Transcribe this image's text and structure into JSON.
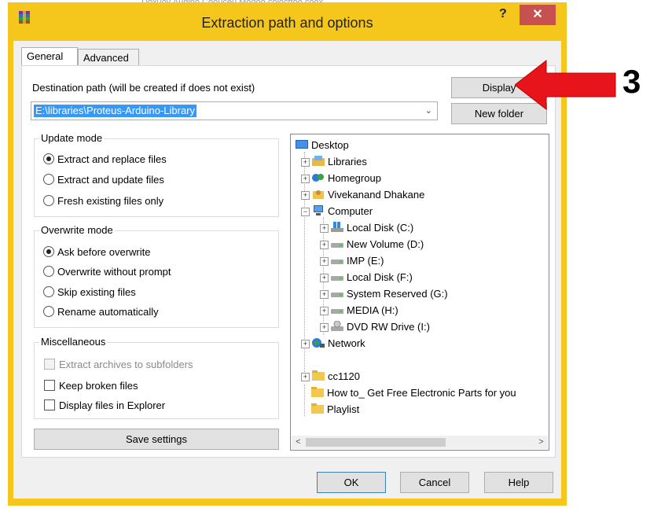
{
  "window": {
    "title": "Extraction path and options",
    "help_label": "?",
    "close_label": "✕"
  },
  "tabs": [
    "General",
    "Advanced"
  ],
  "destination": {
    "label": "Destination path (will be created if does not exist)",
    "value": "E:\\libraries\\Proteus-Arduino-Library"
  },
  "buttons": {
    "display": "Display",
    "new_folder": "New folder",
    "save_settings": "Save settings",
    "ok": "OK",
    "cancel": "Cancel",
    "help": "Help"
  },
  "update_mode": {
    "title": "Update mode",
    "options": [
      "Extract and replace files",
      "Extract and update files",
      "Fresh existing files only"
    ],
    "selected_index": 0
  },
  "overwrite_mode": {
    "title": "Overwrite mode",
    "options": [
      "Ask before overwrite",
      "Overwrite without prompt",
      "Skip existing files",
      "Rename automatically"
    ],
    "selected_index": 0
  },
  "misc": {
    "title": "Miscellaneous",
    "options": [
      {
        "label": "Extract archives to subfolders",
        "checked": false,
        "enabled": false
      },
      {
        "label": "Keep broken files",
        "checked": false,
        "enabled": true
      },
      {
        "label": "Display files in Explorer",
        "checked": false,
        "enabled": true
      }
    ]
  },
  "tree": [
    {
      "label": "Desktop",
      "icon": "desktop-icon"
    },
    {
      "label": "Libraries",
      "icon": "libraries-icon"
    },
    {
      "label": "Homegroup",
      "icon": "homegroup-icon"
    },
    {
      "label": "Vivekanand Dhakane",
      "icon": "user-folder-icon"
    },
    {
      "label": "Computer",
      "icon": "computer-icon"
    },
    {
      "label": "Local Disk (C:)",
      "icon": "system-drive-icon"
    },
    {
      "label": "New Volume (D:)",
      "icon": "drive-icon"
    },
    {
      "label": "IMP (E:)",
      "icon": "drive-icon"
    },
    {
      "label": "Local Disk (F:)",
      "icon": "drive-icon"
    },
    {
      "label": "System Reserved (G:)",
      "icon": "drive-icon"
    },
    {
      "label": "MEDIA (H:)",
      "icon": "drive-icon"
    },
    {
      "label": "DVD RW Drive (I:)",
      "icon": "dvd-drive-icon"
    },
    {
      "label": "Network",
      "icon": "network-icon"
    },
    {
      "label": "cc1120",
      "icon": "folder-icon"
    },
    {
      "label": "How to_ Get Free Electronic Parts for you",
      "icon": "folder-icon"
    },
    {
      "label": "Playlist",
      "icon": "folder-icon"
    }
  ],
  "annotation": {
    "number": "3",
    "arrow_color": "#e8141b"
  },
  "top_strip_text": "Doxuov Audino Coouceu  Modoo colocttoo coox"
}
